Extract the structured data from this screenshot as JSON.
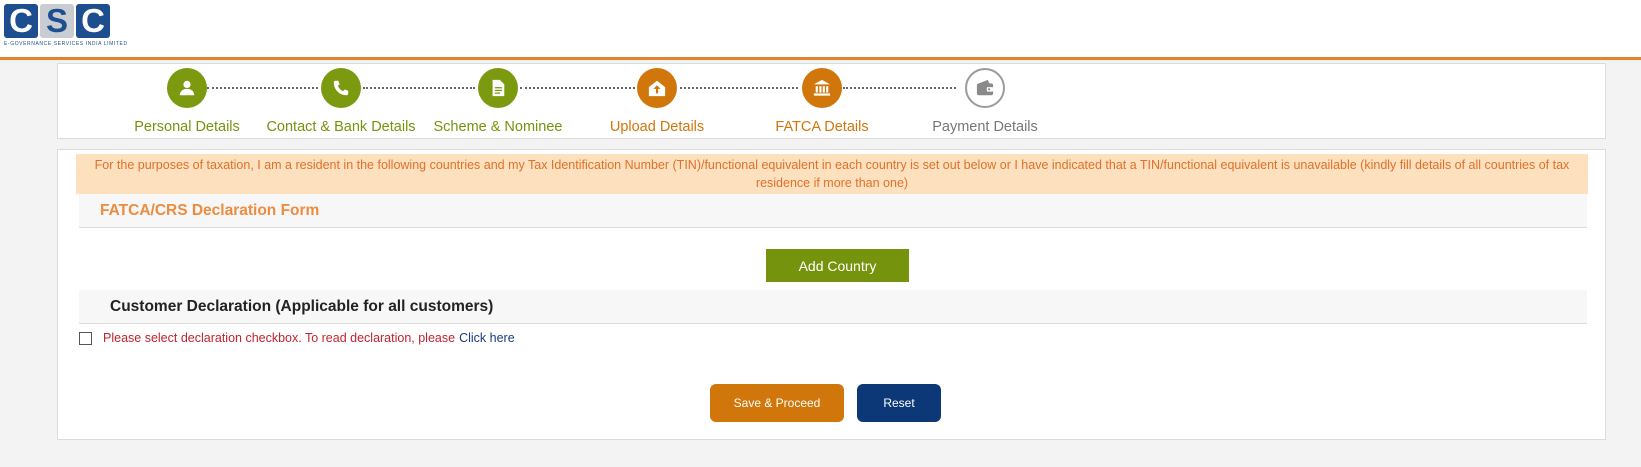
{
  "brand": {
    "logo_letters": [
      "C",
      "S",
      "C"
    ],
    "logo_subtitle": "e-Governance Services India Limited"
  },
  "steps": [
    {
      "label": "Personal Details",
      "icon": "user-icon",
      "status": "completed",
      "color": "#7b9a10"
    },
    {
      "label": "Contact & Bank Details",
      "icon": "phone-icon",
      "status": "completed",
      "color": "#7b9a10"
    },
    {
      "label": "Scheme & Nominee",
      "icon": "document-icon",
      "status": "completed",
      "color": "#7b9a10"
    },
    {
      "label": "Upload Details",
      "icon": "upload-icon",
      "status": "completed",
      "color": "#d1760b"
    },
    {
      "label": "FATCA Details",
      "icon": "bank-icon",
      "status": "active",
      "color": "#d1760b"
    },
    {
      "label": "Payment Details",
      "icon": "wallet-icon",
      "status": "pending",
      "color": "#9b9b9b"
    }
  ],
  "notice": {
    "text": "For the purposes of taxation, I am a resident in the following countries and my Tax Identification Number (TIN)/functional equivalent in each country is set out below or I have indicated that a TIN/functional equivalent is unavailable (kindly fill details of all countries of tax residence if more than one)"
  },
  "fatca": {
    "title": "FATCA/CRS Declaration Form",
    "add_country_label": "Add Country"
  },
  "customer": {
    "title": "Customer Declaration (Applicable for all customers)",
    "declaration_text": "Please select declaration checkbox. To read declaration, please",
    "declaration_link": "Click here",
    "checked": false
  },
  "actions": {
    "save_label": "Save & Proceed",
    "reset_label": "Reset"
  },
  "colors": {
    "accent_orange": "#d1760b",
    "accent_green": "#7b9a10",
    "navy": "#0d3878",
    "notice_bg": "#fde0bd"
  }
}
